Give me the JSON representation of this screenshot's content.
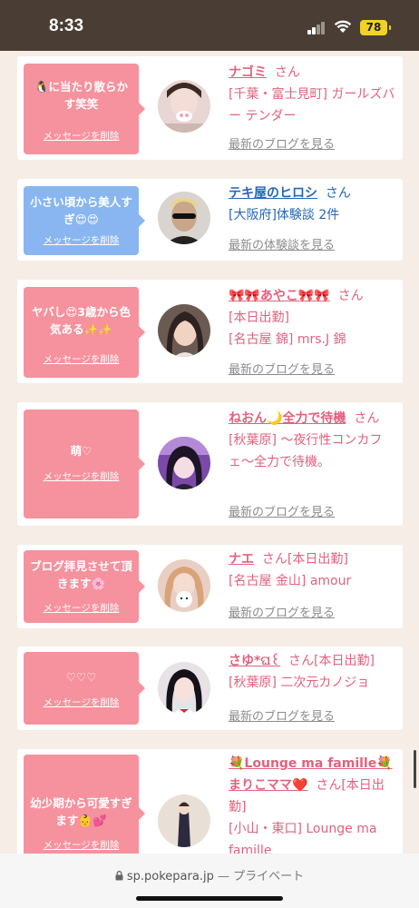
{
  "status": {
    "time": "8:33",
    "battery": "78"
  },
  "entries": [
    {
      "message": "🐧に当たり散らかす笑笑",
      "delete": "メッセージを削除",
      "name": "ナゴミ",
      "suffix": "さん",
      "details": [
        "[千葉・富士見町] ガールズバー テンダー"
      ],
      "link": "最新のブログを見る"
    },
    {
      "message": "小さい頃から美人すぎ😍😍",
      "delete": "メッセージを削除",
      "name": "テキ屋のヒロシ",
      "suffix": "さん",
      "details": [
        "[大阪府]体験談 2件"
      ],
      "link": "最新の体験談を見る"
    },
    {
      "message": "ヤバし😍3歳から色気ある✨✨",
      "delete": "メッセージを削除",
      "name": "🎀🎀あやこ🎀🎀",
      "suffix": "さん",
      "details": [
        "[本日出勤]",
        "[名古屋 錦] mrs.J 錦"
      ],
      "link": "最新のブログを見る"
    },
    {
      "message": "萌♡",
      "delete": "メッセージを削除",
      "name": "ねおん🌙全力で待機",
      "suffix": "さん",
      "details": [
        "[秋葉原] 〜夜行性コンカフェ〜全力で待機。"
      ],
      "link": "最新のブログを見る"
    },
    {
      "message": "ブログ拝見させて頂きます🌸",
      "delete": "メッセージを削除",
      "name": "ナエ",
      "suffix": "さん[本日出勤]",
      "details": [
        "[名古屋 金山] amour"
      ],
      "link": "最新のブログを見る"
    },
    {
      "message": "♡♡♡",
      "delete": "メッセージを削除",
      "name": "さゆ*ଘ꒰",
      "suffix": "さん[本日出勤]",
      "details": [
        "[秋葉原] 二次元カノジョ"
      ],
      "link": "最新のブログを見る"
    },
    {
      "message": "幼少期から可愛すぎます👶💕",
      "delete": "メッセージを削除",
      "name": "💐Lounge ma famille💐まりこママ❤️",
      "suffix": "さん[本日出勤]",
      "details": [
        "[小山・東口] Lounge ma famille"
      ],
      "link": ""
    }
  ],
  "browser": {
    "domain": "sp.pokepara.jp",
    "separator": " — ",
    "private": "プライベート"
  }
}
